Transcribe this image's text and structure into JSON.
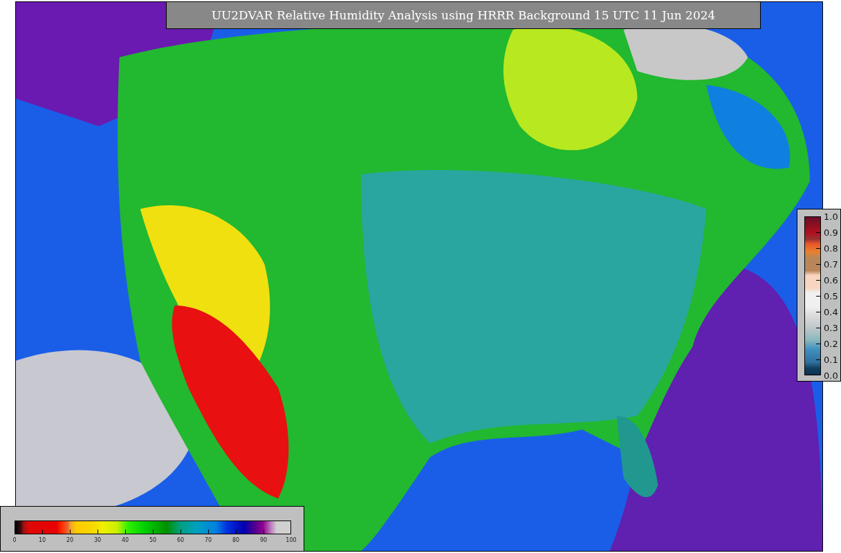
{
  "title": "UU2DVAR Relative Humidity Analysis using HRRR Background 15 UTC 11 Jun 2024",
  "legends": [
    {
      "kind": "horizontal",
      "ticks": [
        "0",
        "10",
        "20",
        "30",
        "40",
        "50",
        "60",
        "70",
        "80",
        "90",
        "100"
      ]
    },
    {
      "kind": "vertical",
      "ticks": [
        "1.0",
        "0.9",
        "0.8",
        "0.7",
        "0.6",
        "0.5",
        "0.4",
        "0.3",
        "0.2",
        "0.1",
        "0.0"
      ]
    }
  ]
}
